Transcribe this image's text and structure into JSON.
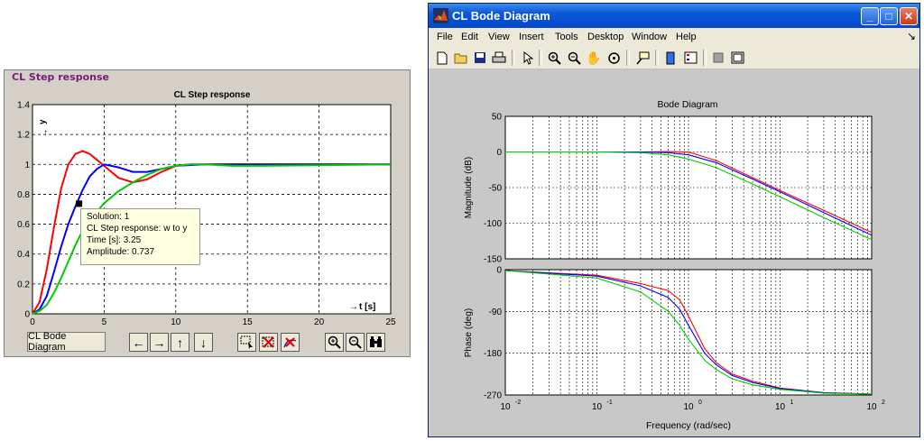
{
  "step_panel": {
    "title": "CL Step response",
    "plot_title": "CL Step response",
    "y_axis_label": "y",
    "x_axis_label": "t [s]",
    "bode_button": "CL Bode Diagram",
    "tooltip": {
      "line1": "Solution: 1",
      "line2": "CL Step response: w to y",
      "line3": "Time [s]: 3.25",
      "line4": "Amplitude: 0.737"
    },
    "nav_buttons": [
      "←",
      "→",
      "↑",
      "↓"
    ],
    "tool_icons": [
      "select-region-icon",
      "clear-selection-icon",
      "delete-curve-icon"
    ],
    "zoom_icons": [
      "zoom-in-icon",
      "zoom-out-icon",
      "find-icon"
    ]
  },
  "bode_window": {
    "title": "CL Bode Diagram",
    "menu": [
      "File",
      "Edit",
      "View",
      "Insert",
      "Tools",
      "Desktop",
      "Window",
      "Help"
    ],
    "plot_title": "Bode Diagram",
    "magnitude_label": "Magnitude (dB)",
    "phase_label": "Phase (deg)",
    "xlabel": "Frequency  (rad/sec)"
  },
  "colors": {
    "red": "#ff0000",
    "blue": "#0000ff",
    "green": "#00cc00",
    "plot_bg": "#ffffff",
    "frame_bg": "#d4d0c8",
    "titlebar": "#0a58d8"
  },
  "chart_data": [
    {
      "type": "line",
      "title": "CL Step response",
      "xlabel": "t [s]",
      "ylabel": "y",
      "xlim": [
        0,
        25
      ],
      "ylim": [
        0,
        1.4
      ],
      "xticks": [
        0,
        5,
        10,
        15,
        20,
        25
      ],
      "yticks": [
        0,
        0.2,
        0.4,
        0.6,
        0.8,
        1,
        1.2,
        1.4
      ],
      "grid": true,
      "series": [
        {
          "color": "red",
          "x": [
            0,
            0.5,
            1,
            1.5,
            2,
            2.5,
            3,
            3.5,
            4,
            5,
            6,
            7,
            8,
            9,
            10,
            11,
            12,
            14,
            16,
            25
          ],
          "y": [
            0,
            0.08,
            0.3,
            0.58,
            0.84,
            1.0,
            1.07,
            1.09,
            1.07,
            0.99,
            0.91,
            0.88,
            0.9,
            0.95,
            0.99,
            1.0,
            1.0,
            1.0,
            1.0,
            1.0
          ]
        },
        {
          "color": "blue",
          "x": [
            0,
            0.5,
            1,
            1.5,
            2,
            2.5,
            3,
            3.5,
            4,
            4.5,
            5,
            6,
            7,
            8,
            9,
            10,
            12,
            14,
            25
          ],
          "y": [
            0,
            0.03,
            0.12,
            0.28,
            0.45,
            0.6,
            0.72,
            0.83,
            0.92,
            0.97,
            1.0,
            0.98,
            0.95,
            0.95,
            0.97,
            0.99,
            1.0,
            1.0,
            1.0
          ]
        },
        {
          "color": "green",
          "x": [
            0,
            0.5,
            1,
            1.5,
            2,
            2.5,
            3,
            3.5,
            4,
            5,
            6,
            7,
            8,
            9,
            10,
            11,
            12,
            14,
            16,
            25
          ],
          "y": [
            0,
            0.02,
            0.06,
            0.14,
            0.24,
            0.35,
            0.46,
            0.56,
            0.63,
            0.74,
            0.82,
            0.88,
            0.93,
            0.97,
            0.99,
            1.0,
            1.0,
            0.99,
            0.99,
            1.0
          ]
        }
      ],
      "marker": {
        "x": 3.25,
        "y": 0.737
      }
    },
    {
      "type": "line",
      "title": "Bode Diagram",
      "subplot": "magnitude",
      "xlabel": "Frequency  (rad/sec)",
      "ylabel": "Magnitude (dB)",
      "xscale": "log",
      "xlim": [
        0.01,
        100
      ],
      "ylim": [
        -150,
        50
      ],
      "xticks": [
        0.01,
        0.1,
        1,
        10,
        100
      ],
      "xtick_labels": [
        "10^-2",
        "10^-1",
        "10^0",
        "10^1",
        "10^2"
      ],
      "yticks": [
        -150,
        -100,
        -50,
        0,
        50
      ],
      "grid": true,
      "series": [
        {
          "color": "red",
          "x": [
            0.01,
            0.1,
            0.3,
            0.6,
            1,
            2,
            5,
            10,
            30,
            100
          ],
          "y": [
            0,
            0,
            0,
            0.5,
            0,
            -12,
            -36,
            -54,
            -82,
            -113
          ]
        },
        {
          "color": "blue",
          "x": [
            0.01,
            0.1,
            0.3,
            0.6,
            1,
            2,
            5,
            10,
            30,
            100
          ],
          "y": [
            0,
            0,
            0,
            -1,
            -4,
            -15,
            -38,
            -56,
            -85,
            -117
          ]
        },
        {
          "color": "green",
          "x": [
            0.01,
            0.1,
            0.3,
            0.6,
            1,
            2,
            5,
            10,
            30,
            100
          ],
          "y": [
            0,
            0,
            -1,
            -4,
            -10,
            -22,
            -45,
            -63,
            -92,
            -123
          ]
        }
      ]
    },
    {
      "type": "line",
      "subplot": "phase",
      "xlabel": "Frequency  (rad/sec)",
      "ylabel": "Phase (deg)",
      "xscale": "log",
      "xlim": [
        0.01,
        100
      ],
      "ylim": [
        -270,
        0
      ],
      "xticks": [
        0.01,
        0.1,
        1,
        10,
        100
      ],
      "xtick_labels": [
        "10^-2",
        "10^-1",
        "10^0",
        "10^1",
        "10^2"
      ],
      "yticks": [
        -270,
        -180,
        -90,
        0
      ],
      "grid": true,
      "series": [
        {
          "color": "red",
          "x": [
            0.01,
            0.1,
            0.3,
            0.6,
            0.8,
            1,
            1.5,
            2,
            3,
            5,
            10,
            30,
            100
          ],
          "y": [
            -2,
            -12,
            -30,
            -45,
            -65,
            -100,
            -170,
            -200,
            -225,
            -240,
            -255,
            -265,
            -268
          ]
        },
        {
          "color": "blue",
          "x": [
            0.01,
            0.1,
            0.3,
            0.6,
            0.8,
            1,
            1.5,
            2,
            3,
            5,
            10,
            30,
            100
          ],
          "y": [
            -2,
            -14,
            -35,
            -60,
            -85,
            -120,
            -180,
            -205,
            -228,
            -243,
            -256,
            -265,
            -268
          ]
        },
        {
          "color": "green",
          "x": [
            0.01,
            0.1,
            0.3,
            0.6,
            0.8,
            1,
            1.5,
            2,
            3,
            5,
            10,
            30,
            100
          ],
          "y": [
            -2,
            -18,
            -48,
            -90,
            -120,
            -150,
            -195,
            -215,
            -235,
            -248,
            -258,
            -266,
            -268
          ]
        }
      ]
    }
  ]
}
